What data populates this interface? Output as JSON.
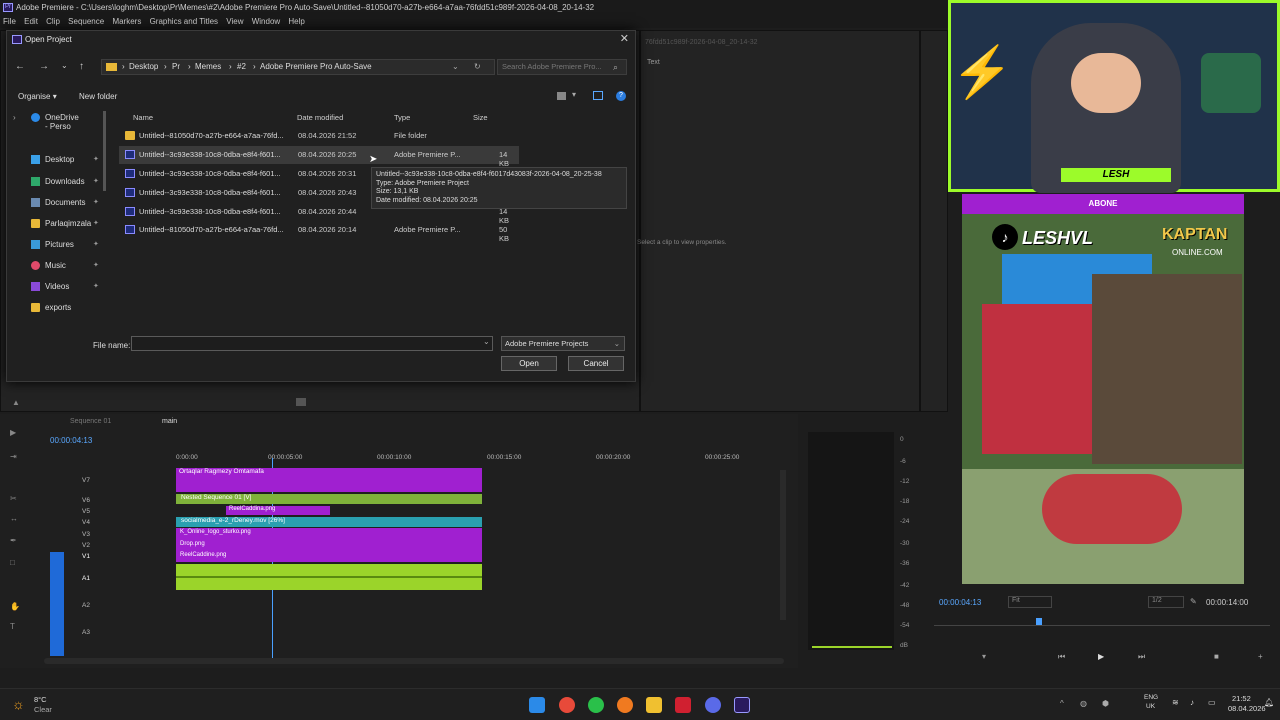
{
  "window": {
    "title": "Adobe Premiere - C:\\Users\\loghm\\Desktop\\Pr\\Memes\\#2\\Adobe Premiere Pro Auto-Save\\Untitled--81050d70-a27b-e664-a7aa-76fdd51c989f-2026-04-08_20-14-32",
    "menu": [
      "File",
      "Edit",
      "Clip",
      "Sequence",
      "Markers",
      "Graphics and Titles",
      "View",
      "Window",
      "Help"
    ]
  },
  "dialog": {
    "title": "Open Project",
    "breadcrumb": [
      "Desktop",
      "Pr",
      "Memes",
      "#2",
      "Adobe Premiere Pro Auto-Save"
    ],
    "search_placeholder": "Search Adobe Premiere Pro...",
    "organise": "Organise",
    "new_folder": "New folder",
    "columns": {
      "name": "Name",
      "date": "Date modified",
      "type": "Type",
      "size": "Size"
    },
    "nav": [
      {
        "label": "OneDrive - Perso",
        "icon": "cloud-icon"
      },
      {
        "label": "Desktop",
        "icon": "desktop-icon"
      },
      {
        "label": "Downloads",
        "icon": "download-icon"
      },
      {
        "label": "Documents",
        "icon": "documents-icon"
      },
      {
        "label": "Parlaqimzala",
        "icon": "folder-icon"
      },
      {
        "label": "Pictures",
        "icon": "pictures-icon"
      },
      {
        "label": "Music",
        "icon": "music-icon"
      },
      {
        "label": "Videos",
        "icon": "videos-icon"
      },
      {
        "label": "exports",
        "icon": "folder-icon"
      }
    ],
    "files": [
      {
        "name": "Untitled--81050d70-a27b-e664-a7aa-76fd...",
        "date": "08.04.2026 21:52",
        "type": "File folder",
        "size": ""
      },
      {
        "name": "Untitled--3c93e338-10c8-0dba-e8f4-f601...",
        "date": "08.04.2026 20:25",
        "type": "Adobe Premiere P...",
        "size": "14 KB"
      },
      {
        "name": "Untitled--3c93e338-10c8-0dba-e8f4-f601...",
        "date": "08.04.2026 20:31",
        "type": "",
        "size": ""
      },
      {
        "name": "Untitled--3c93e338-10c8-0dba-e8f4-f601...",
        "date": "08.04.2026 20:43",
        "type": "",
        "size": ""
      },
      {
        "name": "Untitled--3c93e338-10c8-0dba-e8f4-f601...",
        "date": "08.04.2026 20:44",
        "type": "",
        "size": "14 KB"
      },
      {
        "name": "Untitled--81050d70-a27b-e664-a7aa-76fd...",
        "date": "08.04.2026 20:14",
        "type": "Adobe Premiere P...",
        "size": "50 KB"
      }
    ],
    "tooltip": {
      "line1": "Untitled--3c93e338-10c8-0dba-e8f4-f6017d43083f-2026-04-08_20-25-38",
      "line2": "Type: Adobe Premiere Project",
      "line3": "Size: 13,1 KB",
      "line4": "Date modified: 08.04.2026 20:25"
    },
    "file_name_label": "File name:",
    "file_name_value": "",
    "file_type": "Adobe Premiere Projects",
    "open": "Open",
    "cancel": "Cancel"
  },
  "right_panel": {
    "text_tab": "Text",
    "properties_hint": "Select a clip to view properties.",
    "bg_title": "76fdd51c989f-2026-04-08_20-14-32"
  },
  "timeline": {
    "tabs": [
      "Sequence 01",
      "main"
    ],
    "timecode": "00:00:04:13",
    "ruler": [
      "0:00:00",
      "00:00:05:00",
      "00:00:10:00",
      "00:00:15:00",
      "00:00:20:00",
      "00:00:25:00"
    ],
    "tracks": [
      "V7",
      "V6",
      "V5",
      "V4",
      "V3",
      "V2",
      "V1",
      "A1",
      "A2",
      "A3"
    ],
    "clips": [
      {
        "label": "Ortaqlar Ragmezy Omtamafa"
      },
      {
        "label": "Nested Sequence 01 [V]"
      },
      {
        "label": "ReelCaddina.png"
      },
      {
        "label": "socialmedia_e-2_rDeney.mov [26%]"
      },
      {
        "label": "K_Online_logo_sturko.png"
      },
      {
        "label": "Drop.png"
      },
      {
        "label": "ReelCaddine.png"
      }
    ],
    "meter_scale": [
      "0",
      "-6",
      "-12",
      "-18",
      "-24",
      "-30",
      "-36",
      "-42",
      "-48",
      "-54",
      "dB"
    ]
  },
  "program": {
    "timecode": "00:00:04:13",
    "fit": "Fit",
    "quality": "1/2",
    "duration": "00:00:14:00"
  },
  "overlay": {
    "streamer": "LESH",
    "abone": "ABONE",
    "tiktok": "LESHVL",
    "sponsor": "KAPTAN",
    "sponsor_sub": "ONLINE.COM"
  },
  "taskbar": {
    "temp": "8°C",
    "weather": "Clear",
    "lang1": "ENG",
    "lang2": "UK",
    "time": "21:52",
    "date": "08.04.2026"
  },
  "colors": {
    "accent": "#9cfb2a",
    "clip_magenta": "#a020d0",
    "clip_green": "#7fb23a",
    "clip_teal": "#2aa0b0",
    "audio": "#9bd42a"
  }
}
